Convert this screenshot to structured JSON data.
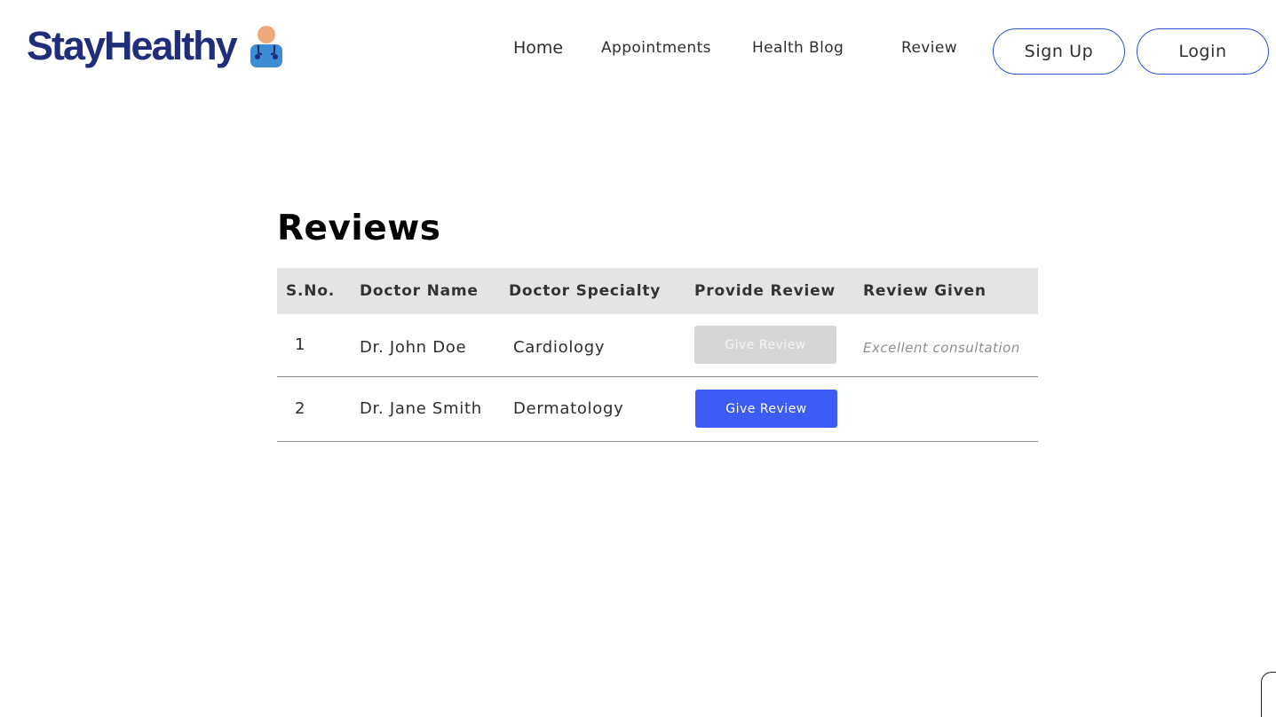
{
  "header": {
    "logo_text": "StayHealthy",
    "logo_icon": "doctor-icon",
    "nav": {
      "home": "Home",
      "appointments": "Appointments",
      "health_blog": "Health Blog",
      "review": "Review"
    },
    "sign_up_label": "Sign Up",
    "login_label": "Login"
  },
  "reviews": {
    "title": "Reviews",
    "columns": {
      "sno": "S.No.",
      "doctor_name": "Doctor Name",
      "doctor_specialty": "Doctor Specialty",
      "provide_review": "Provide Review",
      "review_given": "Review Given"
    },
    "rows": [
      {
        "sno": "1",
        "doctor_name": "Dr. John Doe",
        "specialty": "Cardiology",
        "button_label": "Give Review",
        "button_enabled": false,
        "review_given": "Excellent consultation"
      },
      {
        "sno": "2",
        "doctor_name": "Dr. Jane Smith",
        "specialty": "Dermatology",
        "button_label": "Give Review",
        "button_enabled": true,
        "review_given": ""
      }
    ]
  },
  "colors": {
    "brand_navy": "#1f2d7a",
    "accent_blue": "#3d5cf5",
    "outline_blue": "#2d4fd6",
    "disabled_gray": "#d6d6d6",
    "header_gray": "#e4e4e4"
  }
}
